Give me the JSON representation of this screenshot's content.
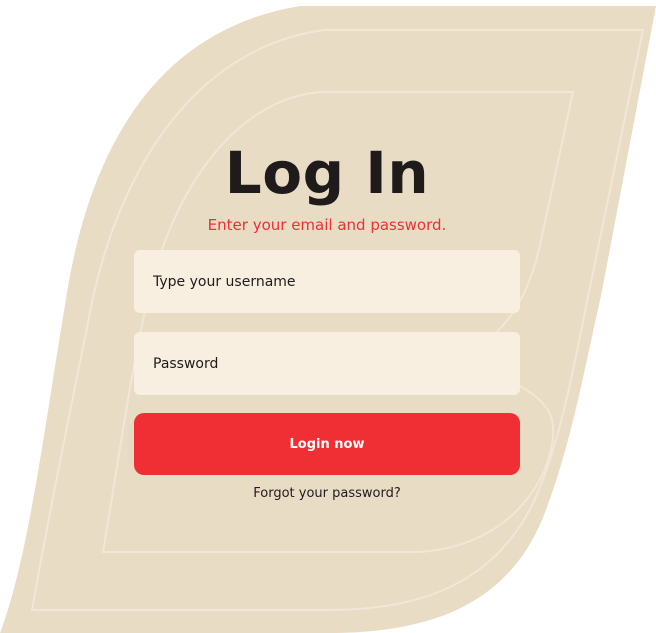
{
  "login": {
    "title": "Log In",
    "subtitle": "Enter your email and password.",
    "username_placeholder": "Type your username",
    "password_placeholder": "Password",
    "login_button_label": "Login now",
    "forgot_password_label": "Forgot your password?"
  },
  "colors": {
    "background_shape": "#e9dcc5",
    "outline": "#f1e7d7",
    "field_background": "#f8efe1",
    "accent_red": "#ef2f33",
    "text_dark": "#1f1b1b",
    "button_text": "#ffffff"
  }
}
